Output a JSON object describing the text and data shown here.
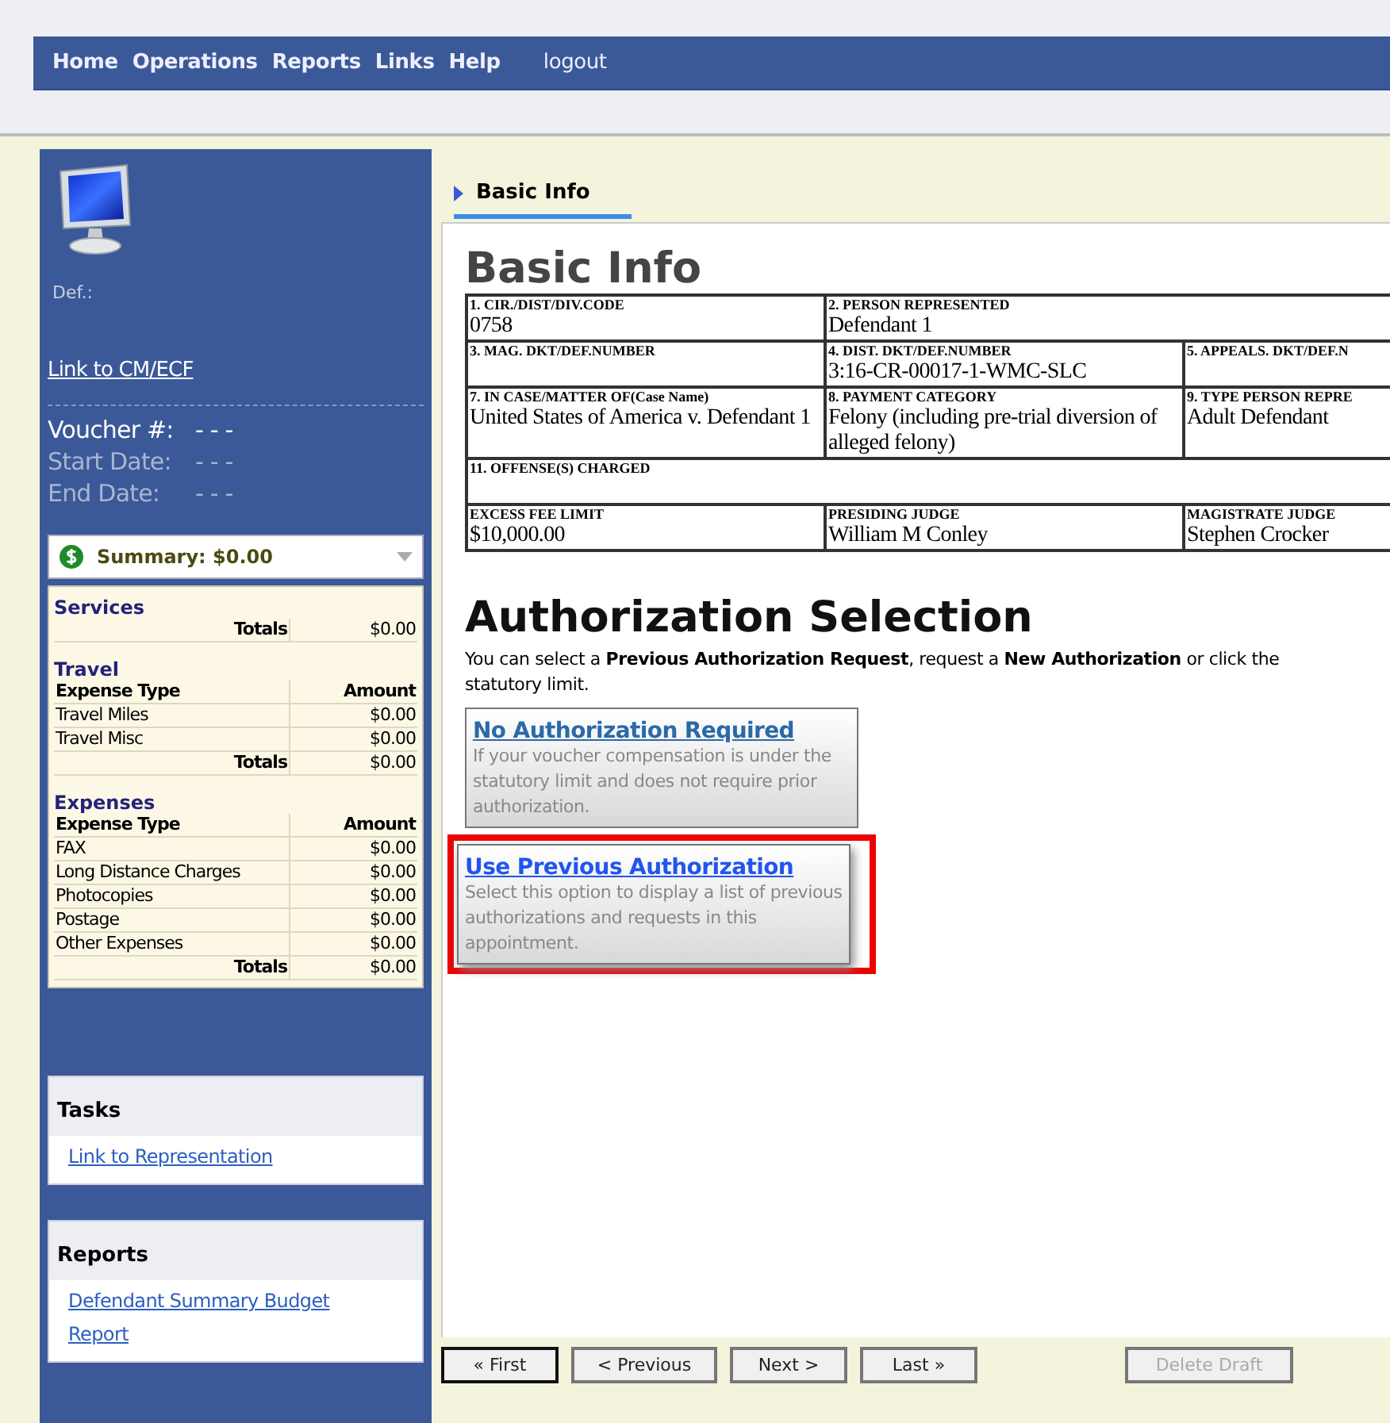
{
  "nav": {
    "items": [
      "Home",
      "Operations",
      "Reports",
      "Links",
      "Help"
    ],
    "logout": "logout"
  },
  "sidebar": {
    "defendant_label": "Def.:",
    "cmecf_link": "Link to CM/ECF",
    "voucher": [
      {
        "label": "Voucher #:",
        "value": "- - -",
        "kind": "main"
      },
      {
        "label": "Start Date:",
        "value": "- - -",
        "kind": "dim"
      },
      {
        "label": "End Date:",
        "value": "- - -",
        "kind": "dim"
      }
    ],
    "summary": {
      "title": "Summary: $0.00",
      "expanded": true,
      "sections": [
        {
          "title": "Services",
          "totals_label": "Totals",
          "totals": "$0.00"
        },
        {
          "title": "Travel",
          "headers": [
            "Expense Type",
            "Amount"
          ],
          "rows": [
            {
              "type": "Travel Miles",
              "amount": "$0.00"
            },
            {
              "type": "Travel Misc",
              "amount": "$0.00"
            }
          ],
          "totals_label": "Totals",
          "totals": "$0.00"
        },
        {
          "title": "Expenses",
          "headers": [
            "Expense Type",
            "Amount"
          ],
          "rows": [
            {
              "type": "FAX",
              "amount": "$0.00"
            },
            {
              "type": "Long Distance Charges",
              "amount": "$0.00"
            },
            {
              "type": "Photocopies",
              "amount": "$0.00"
            },
            {
              "type": "Postage",
              "amount": "$0.00"
            },
            {
              "type": "Other Expenses",
              "amount": "$0.00"
            }
          ],
          "totals_label": "Totals",
          "totals": "$0.00"
        }
      ]
    },
    "panels": [
      {
        "title": "Tasks",
        "links": [
          "Link to Representation"
        ]
      },
      {
        "title": "Reports",
        "links": [
          "Defendant Summary Budget",
          "Report"
        ]
      }
    ]
  },
  "tabs": [
    {
      "label": "Basic Info",
      "selected": true
    }
  ],
  "basic_info": {
    "title": "Basic Info",
    "rows": [
      [
        {
          "label": "1. CIR./DIST/DIV.CODE",
          "value": "0758"
        },
        {
          "label": "2. PERSON REPRESENTED",
          "value": "Defendant 1",
          "colspan": 2
        }
      ],
      [
        {
          "label": "3. MAG. DKT/DEF.NUMBER"
        },
        {
          "label": "4. DIST. DKT/DEF.NUMBER",
          "value": "3:16-CR-00017-1-WMC-SLC"
        },
        {
          "label": "5. APPEALS. DKT/DEF.N"
        }
      ],
      [
        {
          "label": "7. IN CASE/MATTER OF(Case Name)",
          "value": "United States of America v. Defendant 1"
        },
        {
          "label": "8. PAYMENT CATEGORY",
          "value": "Felony (including pre-trial diversion of alleged felony)"
        },
        {
          "label": "9. TYPE PERSON REPRE",
          "value": "Adult Defendant"
        }
      ],
      [
        {
          "label": "11. OFFENSE(S) CHARGED",
          "colspan": 3
        }
      ],
      [
        {
          "label": "EXCESS FEE LIMIT",
          "value": "$10,000.00"
        },
        {
          "label": "PRESIDING JUDGE",
          "value": "William M Conley"
        },
        {
          "label": "MAGISTRATE JUDGE",
          "value": "Stephen Crocker"
        }
      ]
    ]
  },
  "authorization": {
    "title": "Authorization Selection",
    "intro": [
      "You can select a **Previous Authorization Request**, request a **New Authorization** or click the",
      "statutory limit."
    ],
    "options": [
      {
        "title": "No Authorization Required",
        "description": "If your voucher compensation is under the statutory limit and does not require prior authorization.",
        "highlighted": false
      },
      {
        "title": "Use Previous Authorization",
        "description": "Select this option to display a list of previous authorizations and requests in this appointment.",
        "highlighted": true
      }
    ]
  },
  "buttons": [
    {
      "label": "« First",
      "focused": true,
      "disabled": false,
      "kind": "nav"
    },
    {
      "label": "< Previous",
      "focused": false,
      "disabled": false,
      "kind": "nav"
    },
    {
      "label": "Next >",
      "focused": false,
      "disabled": false,
      "kind": "nav"
    },
    {
      "label": "Last »",
      "focused": false,
      "disabled": false,
      "kind": "nav"
    },
    {
      "label": "Delete Draft",
      "focused": false,
      "disabled": true,
      "kind": "action"
    }
  ]
}
